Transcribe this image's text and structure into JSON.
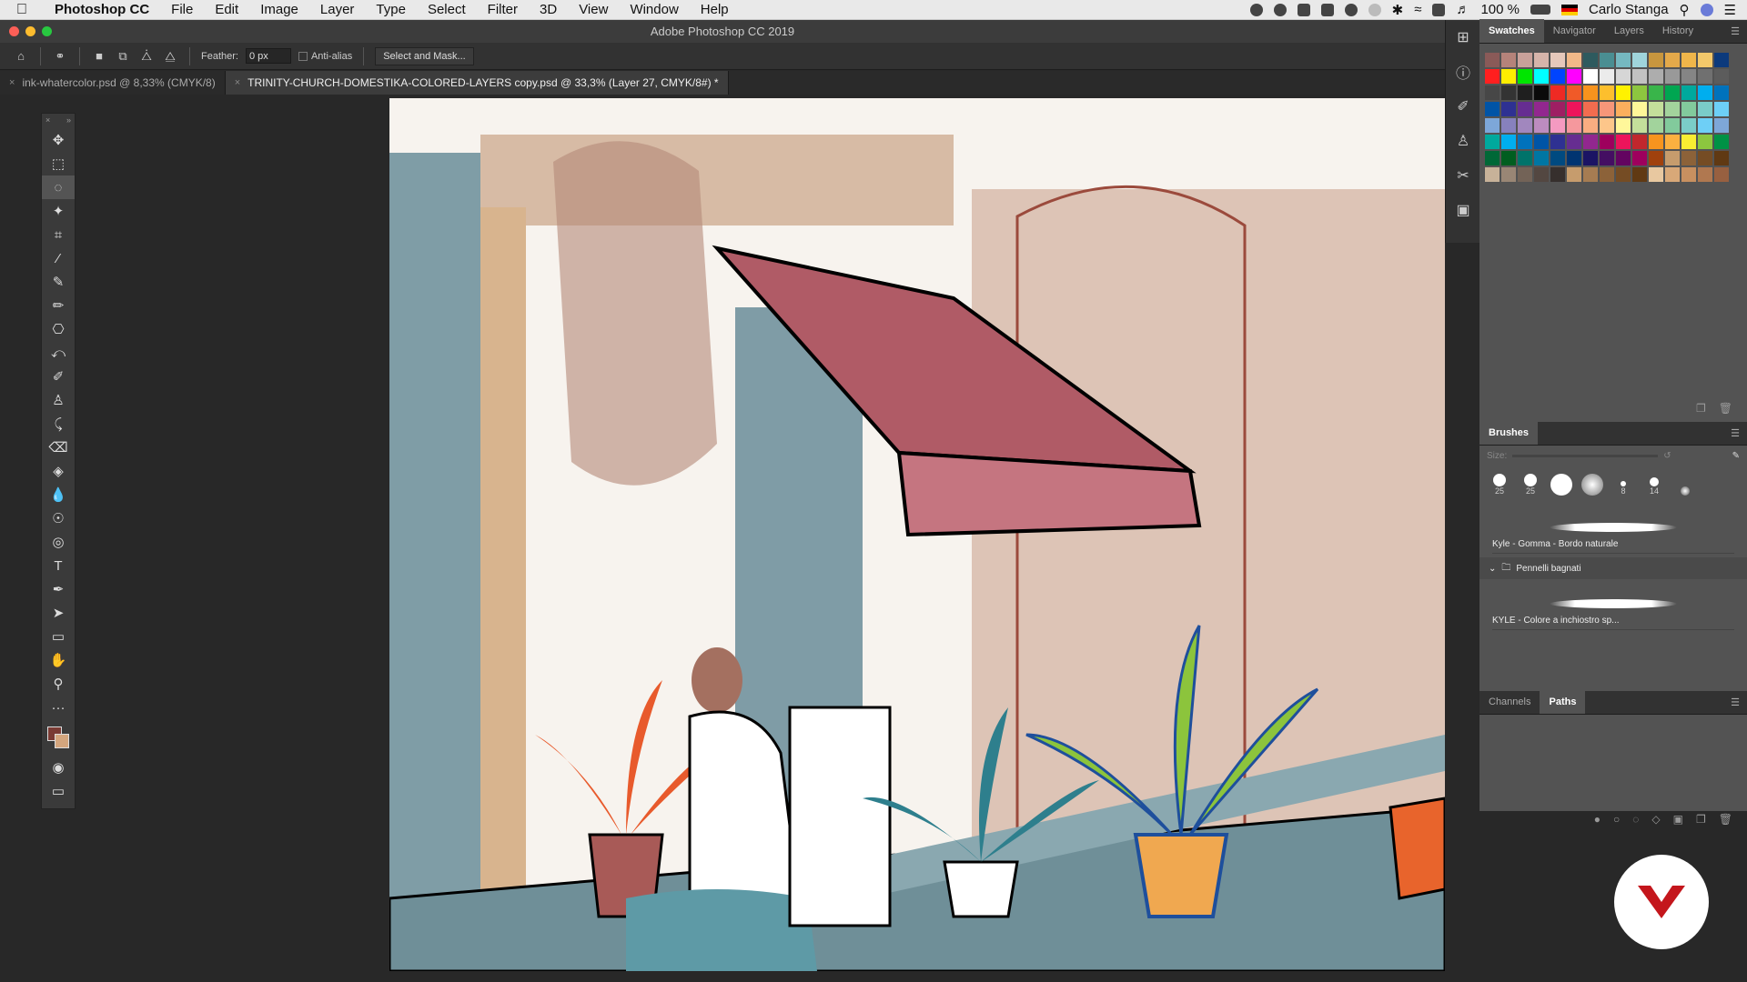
{
  "menubar": {
    "apple": "",
    "items": [
      "Photoshop CC",
      "File",
      "Edit",
      "Image",
      "Layer",
      "Type",
      "Select",
      "Filter",
      "3D",
      "View",
      "Window",
      "Help"
    ],
    "battery": "100 %",
    "user": "Carlo Stanga"
  },
  "window": {
    "title": "Adobe Photoshop CC 2019"
  },
  "options": {
    "feather_label": "Feather:",
    "feather_value": "0 px",
    "antialias_label": "Anti-alias",
    "select_mask_label": "Select and Mask..."
  },
  "tabs": [
    {
      "label": "ink-whatercolor.psd @ 8,33% (CMYK/8)",
      "active": false
    },
    {
      "label": "TRINITY-CHURCH-DOMESTIKA-COLORED-LAYERS copy.psd @ 33,3% (Layer 27, CMYK/8#) *",
      "active": true
    }
  ],
  "tools": [
    {
      "name": "move-tool",
      "icon": "✥"
    },
    {
      "name": "marquee-tool",
      "icon": "⬚"
    },
    {
      "name": "lasso-tool",
      "icon": "◌"
    },
    {
      "name": "magic-wand-tool",
      "icon": "✦"
    },
    {
      "name": "crop-tool",
      "icon": "⌗"
    },
    {
      "name": "eyedropper-tool",
      "icon": "⁄"
    },
    {
      "name": "healing-brush-tool",
      "icon": "✎"
    },
    {
      "name": "pencil-tool",
      "icon": "✏"
    },
    {
      "name": "clone-stamp-tool",
      "icon": "⎔"
    },
    {
      "name": "history-brush-tool",
      "icon": "⤺"
    },
    {
      "name": "mixer-brush-tool",
      "icon": "✐"
    },
    {
      "name": "stamp-tool",
      "icon": "♙"
    },
    {
      "name": "art-history-tool",
      "icon": "⤹"
    },
    {
      "name": "eraser-tool",
      "icon": "⌫"
    },
    {
      "name": "paint-bucket-tool",
      "icon": "◈"
    },
    {
      "name": "blur-tool",
      "icon": "💧"
    },
    {
      "name": "dodge-tool",
      "icon": "☉"
    },
    {
      "name": "sponge-tool",
      "icon": "◎"
    },
    {
      "name": "type-tool",
      "icon": "T"
    },
    {
      "name": "pen-tool",
      "icon": "✒"
    },
    {
      "name": "path-selection-tool",
      "icon": "➤"
    },
    {
      "name": "rectangle-tool",
      "icon": "▭"
    },
    {
      "name": "hand-tool",
      "icon": "✋"
    },
    {
      "name": "zoom-tool",
      "icon": "⚲"
    },
    {
      "name": "more-tools",
      "icon": "···"
    }
  ],
  "panels": {
    "top_tabs": [
      "Swatches",
      "Navigator",
      "Layers",
      "History"
    ],
    "brushes_title": "Brushes",
    "size_label": "Size:",
    "brush_tips": [
      "25",
      "25",
      "",
      "",
      "8",
      "14",
      ""
    ],
    "brush_items": [
      {
        "label": "Kyle - Gomma - Bordo naturale"
      },
      {
        "label": "KYLE - Colore a inchiostro sp..."
      }
    ],
    "brush_group": "Pennelli bagnati",
    "bottom_tabs": [
      "Channels",
      "Paths"
    ]
  },
  "swatches": [
    [
      "#8a5a58",
      "#b5837a",
      "#c9a19a",
      "#d6b4aa",
      "#e6c8bb",
      "#f2b888",
      "#2e5a5e",
      "#4a8e92",
      "#75b8c0",
      "#9fd4db",
      "#c8963e",
      "#e4a94a",
      "#f0b64a",
      "#f3c86a",
      "#0c3a7c"
    ],
    [
      "#ff1f1f",
      "#ffee00",
      "#00e600",
      "#00ffff",
      "#0044ff",
      "#ff00ff",
      "#ffffff",
      "#ebebeb",
      "#d6d6d6",
      "#c2c2c2",
      "#adadad",
      "#999999",
      "#858585",
      "#707070",
      "#5c5c5c"
    ],
    [
      "#474747",
      "#333333",
      "#1f1f1f",
      "#0a0a0a",
      "#ee2a24",
      "#f05a28",
      "#f7931d",
      "#fdbf2d",
      "#fff200",
      "#8dc63f",
      "#39b54a",
      "#00a651",
      "#00a99d",
      "#00aeef",
      "#0072bc"
    ],
    [
      "#0054a6",
      "#2e3192",
      "#662d91",
      "#92278f",
      "#9e1f63",
      "#ed145b",
      "#f26c4f",
      "#f69679",
      "#fbaf5d",
      "#fff799",
      "#c4df9b",
      "#a3d39c",
      "#82ca9c",
      "#7accc8",
      "#6dcff6"
    ],
    [
      "#7da7d9",
      "#8781bd",
      "#a187be",
      "#bd8cbf",
      "#f49ac1",
      "#f5989d",
      "#f9ad81",
      "#fdc68a",
      "#fff79a",
      "#c4df9b",
      "#a2d39c",
      "#82ca9c",
      "#7bcdc8",
      "#6ecff6",
      "#7ea7d8"
    ],
    [
      "#00a99d",
      "#00aeef",
      "#0072bc",
      "#0054a6",
      "#2e3192",
      "#662d91",
      "#92278f",
      "#9e005d",
      "#ed145b",
      "#c1272d",
      "#f7941e",
      "#fbb040",
      "#f9ed32",
      "#8cc63f",
      "#009245"
    ],
    [
      "#006837",
      "#005e20",
      "#00736a",
      "#0076a3",
      "#004a80",
      "#003471",
      "#1b1464",
      "#440e62",
      "#630460",
      "#9e005d",
      "#a0410d",
      "#c69c6d",
      "#8c6239",
      "#754c24",
      "#603913"
    ],
    [
      "#c7b299",
      "#998675",
      "#736357",
      "#534741",
      "#362f2d",
      "#c69c6d",
      "#a67c52",
      "#8c6239",
      "#754c24",
      "#603913",
      "#e8c8a0",
      "#d8a878",
      "#c89060",
      "#b07850",
      "#986040"
    ]
  ],
  "colors": {
    "foreground": "#7a3b34",
    "background": "#d4a67e",
    "accent_red": "#c4161c"
  }
}
